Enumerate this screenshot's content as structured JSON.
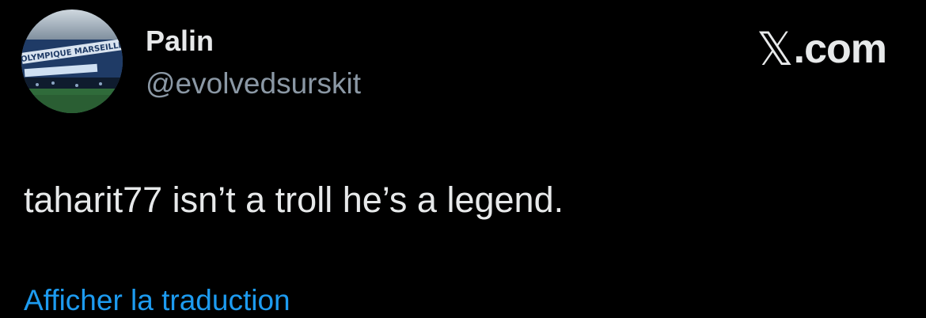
{
  "author": {
    "display_name": "Palin",
    "handle": "@evolvedsurskit",
    "avatar_icon": "stadium-banner-avatar",
    "avatar_banner_text": "OLYMPIQUE MARSEILLE"
  },
  "brand": {
    "x_glyph": "𝕏",
    "suffix": ".com",
    "icon": "x-logo-icon"
  },
  "tweet": {
    "text": "taharit77 isn’t a troll he’s a legend."
  },
  "actions": {
    "translate_label": "Afficher la traduction"
  },
  "colors": {
    "background": "#000000",
    "primary_text": "#e7e9ea",
    "secondary_text": "#8b98a5",
    "link": "#1d9bf0"
  }
}
